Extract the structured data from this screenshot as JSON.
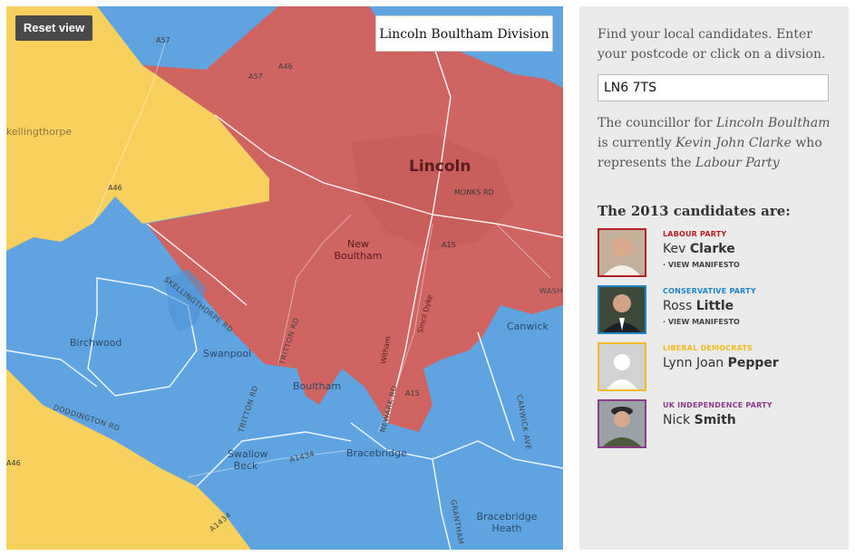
{
  "map": {
    "reset_label": "Reset view",
    "division_label": "Lincoln Boultham Division",
    "colors": {
      "labour": "#cf6460",
      "conservative": "#5fa4e0",
      "libdem": "#f7d05e",
      "water": "#7ab4e8"
    },
    "places": {
      "lincoln": "Lincoln",
      "new_boultham": "New Boultham",
      "birchwood": "Birchwood",
      "swanpool": "Swanpool",
      "boultham": "Boultham",
      "canwick": "Canwick",
      "swallow_beck": "Swallow Beck",
      "bracebridge": "Bracebridge",
      "bracebridge_heath": "Bracebridge Heath",
      "skellingthorpe": "kellingthorpe"
    },
    "roads": {
      "a57": "A57",
      "a46_top": "A46",
      "a57_left": "A57",
      "a46_left": "A46",
      "monks_rd": "MONKS RD",
      "a15_mid": "A15",
      "a15_low": "A15",
      "a1434": "A1434",
      "a46_bottom": "A46",
      "tritton_rd": "TRITTON RD",
      "tritton_rd2": "TRITTON RD",
      "doddington_rd": "DODDINGTON RD",
      "newark_rd": "NEWARK RD",
      "canwick_ave": "CANWICK AVE",
      "skellingthorpe_rd": "SKELLINGTHORPE RD",
      "sincil_dyke": "Sincil Dyke",
      "witham": "Witham",
      "grantham": "GRANTHAM",
      "wash": "WASH",
      "a1434_lower": "A1434"
    }
  },
  "panel": {
    "intro": "Find your local candidates. Enter your postcode or click on a divsion.",
    "postcode_value": "LN6 7TS",
    "councillor_pre": "The councillor for ",
    "division_name": "Lincoln Boultham",
    "councillor_mid": " is currently ",
    "councillor_name": "Kevin John Clarke",
    "councillor_post": " who represents the ",
    "councillor_party": "Labour Party",
    "candidates_heading": "The 2013 candidates are:",
    "candidates": [
      {
        "party": "LABOUR PARTY",
        "first": "Kev",
        "last": "Clarke",
        "color": "#b21f24",
        "manifesto": "· VIEW MANIFESTO",
        "photo_icon": "person-photo"
      },
      {
        "party": "CONSERVATIVE PARTY",
        "first": "Ross",
        "last": "Little",
        "color": "#1b87c9",
        "manifesto": "· VIEW MANIFESTO",
        "photo_icon": "person-photo"
      },
      {
        "party": "LIBERAL DEMOCRATS",
        "first": "Lynn Joan",
        "last": "Pepper",
        "color": "#f4bb22",
        "manifesto": "",
        "photo_icon": "placeholder-avatar-icon"
      },
      {
        "party": "UK INDEPENDENCE PARTY",
        "first": "Nick",
        "last": "Smith",
        "color": "#8c3c8c",
        "manifesto": "",
        "photo_icon": "person-photo"
      }
    ]
  }
}
